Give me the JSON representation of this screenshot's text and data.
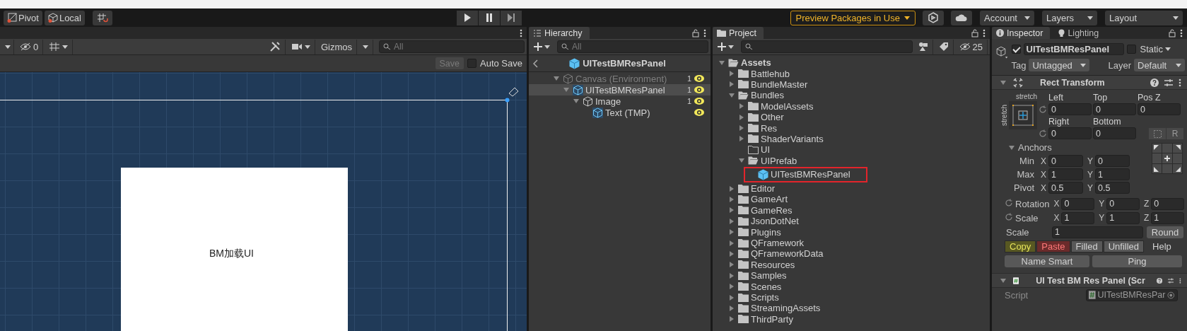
{
  "toolbar": {
    "tools": [
      {
        "label": "Pivot",
        "kind": "pivot"
      },
      {
        "label": "Local",
        "kind": "local"
      }
    ],
    "preview_packages": "Preview Packages in Use",
    "dropdowns": [
      "Account",
      "Layers",
      "Layout"
    ]
  },
  "scene": {
    "hidden_count": "0",
    "gizmos": "Gizmos",
    "search_placeholder": "All",
    "save": {
      "label": "Save",
      "disabled": true
    },
    "auto_save": {
      "label": "Auto Save",
      "checked": false
    },
    "canvas_text": "BM加载UI"
  },
  "hierarchy": {
    "tab": "Hierarchy",
    "search_placeholder": "All",
    "breadcrumb": "UITestBMResPanel",
    "items": [
      {
        "label": "Canvas (Environment)",
        "kind": "object",
        "dimmed": true,
        "selected": false,
        "expanded": true,
        "count": "1",
        "visible": true,
        "children": [
          {
            "label": "UITestBMResPanel",
            "kind": "prefab",
            "dimmed": false,
            "selected": true,
            "expanded": true,
            "count": "1",
            "visible": true,
            "children": [
              {
                "label": "Image",
                "kind": "object",
                "dimmed": false,
                "selected": false,
                "expanded": true,
                "count": "1",
                "visible": true,
                "children": [
                  {
                    "label": "Text (TMP)",
                    "kind": "prefab",
                    "dimmed": false,
                    "selected": false,
                    "visible": true
                  }
                ]
              }
            ]
          }
        ]
      }
    ]
  },
  "project": {
    "tab": "Project",
    "hidden_count": "25",
    "tree": [
      {
        "label": "Assets",
        "kind": "folder",
        "expanded": true,
        "children": [
          {
            "label": "Battlehub",
            "kind": "folder",
            "expanded": false
          },
          {
            "label": "BundleMaster",
            "kind": "folder",
            "expanded": false
          },
          {
            "label": "Bundles",
            "kind": "folder",
            "expanded": true,
            "children": [
              {
                "label": "ModelAssets",
                "kind": "folder",
                "expanded": false
              },
              {
                "label": "Other",
                "kind": "folder",
                "expanded": false
              },
              {
                "label": "Res",
                "kind": "folder",
                "expanded": false
              },
              {
                "label": "ShaderVariants",
                "kind": "folder",
                "expanded": false
              },
              {
                "label": "UI",
                "kind": "empty-folder"
              },
              {
                "label": "UIPrefab",
                "kind": "folder",
                "expanded": true,
                "children": [
                  {
                    "label": "UITestBMResPanel",
                    "kind": "prefab",
                    "outlined": true
                  }
                ]
              }
            ]
          },
          {
            "label": "Editor",
            "kind": "folder",
            "expanded": false
          },
          {
            "label": "GameArt",
            "kind": "folder",
            "expanded": false
          },
          {
            "label": "GameRes",
            "kind": "folder",
            "expanded": false
          },
          {
            "label": "JsonDotNet",
            "kind": "folder",
            "expanded": false
          },
          {
            "label": "Plugins",
            "kind": "folder",
            "expanded": false
          },
          {
            "label": "QFramework",
            "kind": "folder",
            "expanded": false
          },
          {
            "label": "QFrameworkData",
            "kind": "folder",
            "expanded": false
          },
          {
            "label": "Resources",
            "kind": "folder",
            "expanded": false
          },
          {
            "label": "Samples",
            "kind": "folder",
            "expanded": false
          },
          {
            "label": "Scenes",
            "kind": "folder",
            "expanded": false
          },
          {
            "label": "Scripts",
            "kind": "folder",
            "expanded": false
          },
          {
            "label": "StreamingAssets",
            "kind": "folder",
            "expanded": false
          },
          {
            "label": "ThirdParty",
            "kind": "folder",
            "expanded": false
          }
        ]
      }
    ]
  },
  "inspector": {
    "tabs": [
      {
        "label": "Inspector",
        "kind": "info",
        "selected": true
      },
      {
        "label": "Lighting",
        "kind": "bulb",
        "selected": false
      }
    ],
    "active": true,
    "name": "UITestBMResPanel",
    "static": {
      "label": "Static",
      "checked": false
    },
    "tag": {
      "label": "Tag",
      "value": "Untagged"
    },
    "layer": {
      "label": "Layer",
      "value": "Default"
    },
    "rect_transform": {
      "title": "Rect Transform",
      "expanded": true,
      "anchor_horizontal": "stretch",
      "anchor_vertical": "stretch",
      "offsets": [
        [
          {
            "label": "Left",
            "value": "0"
          },
          {
            "label": "Top",
            "value": "0"
          },
          {
            "label": "Pos Z",
            "value": "0"
          }
        ],
        [
          {
            "label": "Right",
            "value": "0"
          },
          {
            "label": "Bottom",
            "value": "0"
          }
        ]
      ],
      "raw_button": "R",
      "anchors": {
        "label": "Anchors",
        "expanded": true,
        "rows": [
          {
            "label": "Min",
            "fields": [
              {
                "axis": "X",
                "value": "0"
              },
              {
                "axis": "Y",
                "value": "0"
              }
            ]
          },
          {
            "label": "Max",
            "fields": [
              {
                "axis": "X",
                "value": "1"
              },
              {
                "axis": "Y",
                "value": "1"
              }
            ]
          }
        ]
      },
      "pivot": {
        "label": "Pivot",
        "fields": [
          {
            "axis": "X",
            "value": "0.5"
          },
          {
            "axis": "Y",
            "value": "0.5"
          }
        ]
      },
      "transforms": [
        {
          "label": "Rotation",
          "fields": [
            {
              "axis": "X",
              "value": "0"
            },
            {
              "axis": "Y",
              "value": "0"
            },
            {
              "axis": "Z",
              "value": "0"
            }
          ]
        },
        {
          "label": "Scale",
          "fields": [
            {
              "axis": "X",
              "value": "1"
            },
            {
              "axis": "Y",
              "value": "1"
            },
            {
              "axis": "Z",
              "value": "1"
            }
          ]
        }
      ]
    },
    "uniform_scale": {
      "label": "Scale",
      "value": "1",
      "button": "Round"
    },
    "tool_buttons": [
      {
        "label": "Copy",
        "kind": "copy"
      },
      {
        "label": "Paste",
        "kind": "paste"
      },
      {
        "label": "Filled",
        "kind": "plain"
      },
      {
        "label": "Unfilled",
        "kind": "plain"
      },
      {
        "label": "Help",
        "kind": "link"
      }
    ],
    "wide_buttons": [
      "Name Smart",
      "Ping"
    ],
    "script_component": {
      "title": "UI Test BM Res Panel (Scr",
      "expanded": true,
      "field": {
        "label": "Script",
        "value": "UITestBMResPar"
      }
    }
  }
}
